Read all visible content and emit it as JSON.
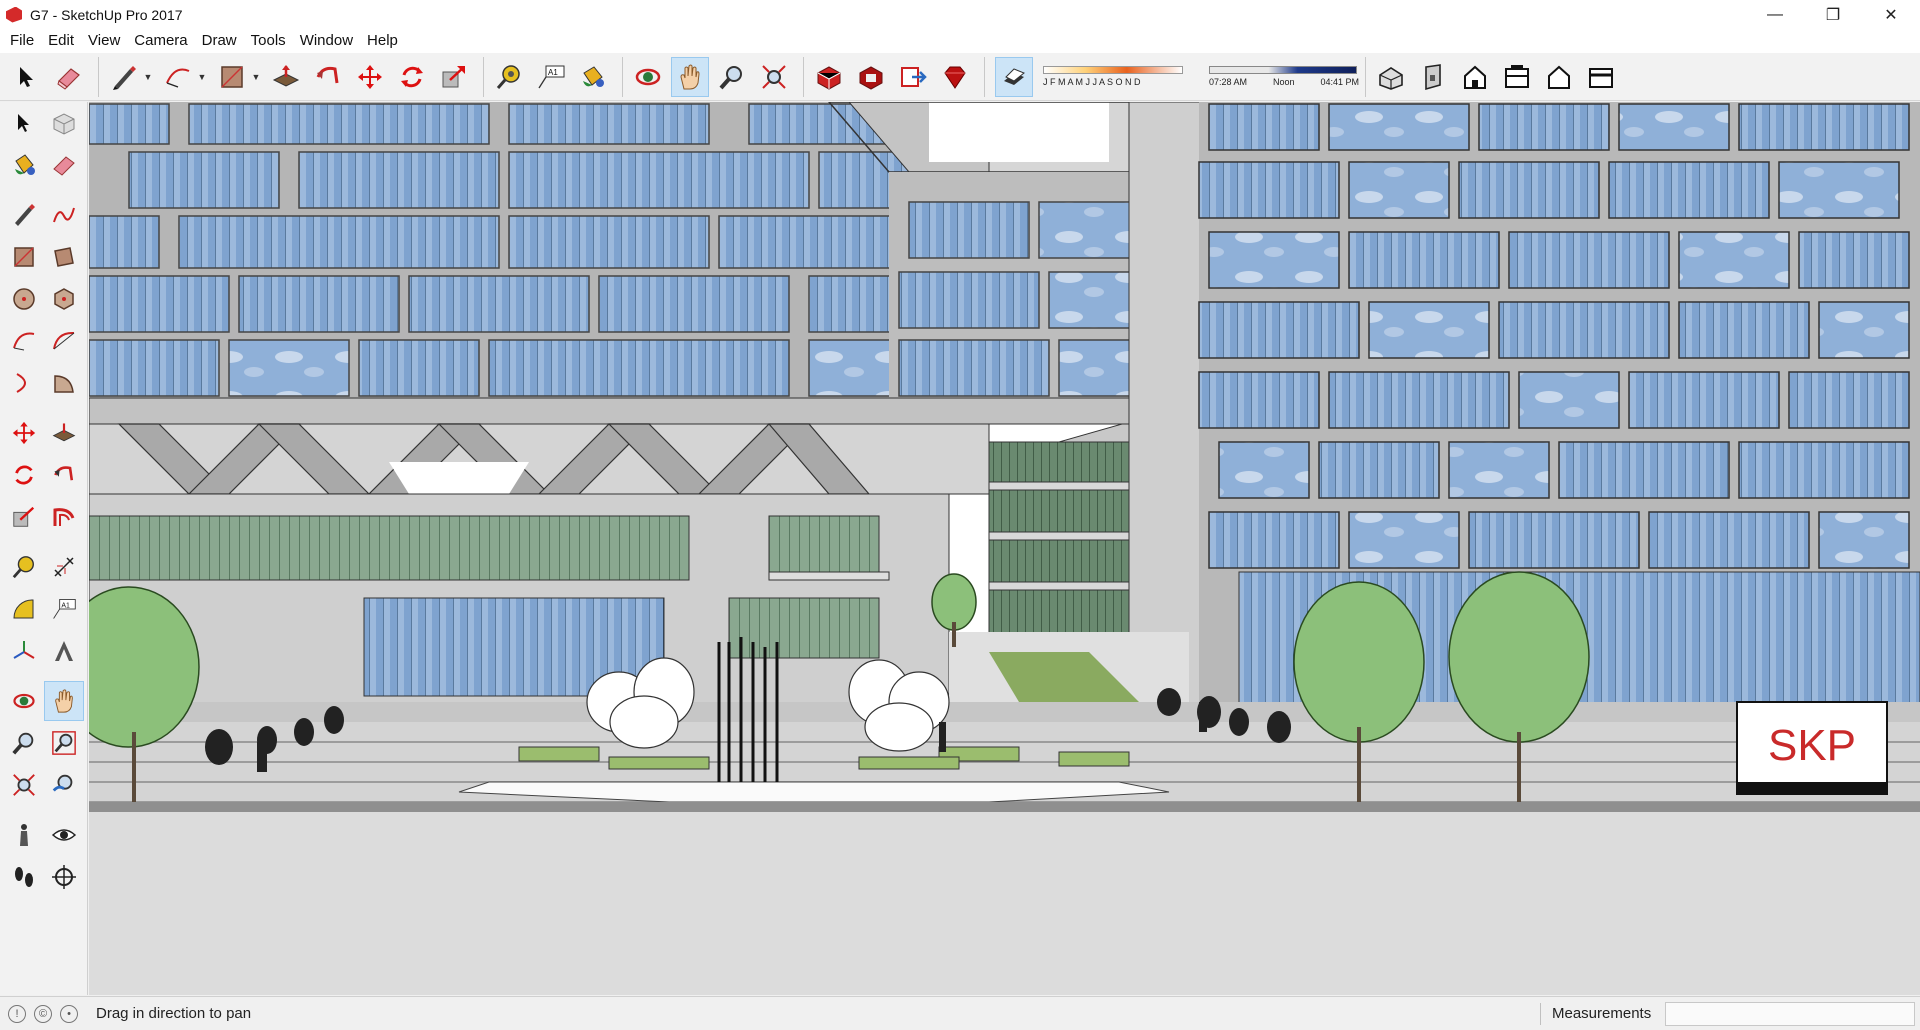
{
  "window": {
    "title": "G7 - SketchUp Pro 2017",
    "controls": {
      "minimize": "—",
      "maximize": "❐",
      "close": "✕"
    }
  },
  "menu": [
    "File",
    "Edit",
    "View",
    "Camera",
    "Draw",
    "Tools",
    "Window",
    "Help"
  ],
  "toolbar": {
    "tools": [
      {
        "icon": "select-arrow-icon"
      },
      {
        "icon": "eraser-icon"
      },
      {
        "icon": "pencil-line-icon",
        "dropdown": true
      },
      {
        "icon": "arc-icon",
        "dropdown": true
      },
      {
        "icon": "rectangle-icon",
        "dropdown": true
      },
      {
        "icon": "push-pull-icon"
      },
      {
        "icon": "follow-me-icon"
      },
      {
        "icon": "move-icon"
      },
      {
        "icon": "rotate-icon"
      },
      {
        "icon": "scale-icon"
      },
      {
        "icon": "tape-measure-icon"
      },
      {
        "icon": "text-tool-icon"
      },
      {
        "icon": "paint-bucket-icon"
      },
      {
        "icon": "orbit-icon"
      },
      {
        "icon": "pan-hand-icon",
        "active": true
      },
      {
        "icon": "zoom-icon"
      },
      {
        "icon": "zoom-extents-icon"
      },
      {
        "icon": "3d-warehouse-icon"
      },
      {
        "icon": "extension-warehouse-icon"
      },
      {
        "icon": "send-to-layout-icon"
      },
      {
        "icon": "ruby-extension-icon"
      }
    ],
    "shadows": {
      "toggle_icon": "shadow-toggle-icon",
      "months": "J F M A M J J A S O N D",
      "time_start": "07:28 AM",
      "time_mid": "Noon",
      "time_end": "04:41 PM"
    },
    "views": [
      {
        "icon": "iso-view-icon"
      },
      {
        "icon": "top-view-icon"
      },
      {
        "icon": "front-view-icon"
      },
      {
        "icon": "right-view-icon"
      },
      {
        "icon": "back-view-icon"
      },
      {
        "icon": "left-view-icon"
      }
    ]
  },
  "left_tools": [
    [
      "select-arrow-icon",
      "make-component-icon"
    ],
    [
      "paint-bucket-icon",
      "eraser-icon"
    ],
    [
      "pencil-line-icon",
      "freehand-icon"
    ],
    [
      "rectangle-icon",
      "rotated-rectangle-icon"
    ],
    [
      "circle-icon",
      "polygon-icon"
    ],
    [
      "arc-icon",
      "two-point-arc-icon"
    ],
    [
      "three-point-arc-icon",
      "pie-icon"
    ],
    [
      "move-icon",
      "push-pull-icon"
    ],
    [
      "rotate-icon",
      "follow-me-icon"
    ],
    [
      "scale-icon",
      "offset-icon"
    ],
    [
      "tape-measure-icon",
      "dimension-icon"
    ],
    [
      "protractor-icon",
      "text-tool-icon"
    ],
    [
      "axes-icon",
      "3d-text-icon"
    ],
    [
      "orbit-icon",
      "pan-hand-icon"
    ],
    [
      "zoom-icon",
      "zoom-window-icon"
    ],
    [
      "zoom-extents-icon",
      "previous-view-icon"
    ],
    [
      "position-camera-icon",
      "look-around-icon"
    ],
    [
      "walk-icon",
      "section-plane-icon"
    ]
  ],
  "watermark": "SKP",
  "statusbar": {
    "hint": "Drag in direction to pan",
    "measurements_label": "Measurements",
    "measurements_value": ""
  }
}
